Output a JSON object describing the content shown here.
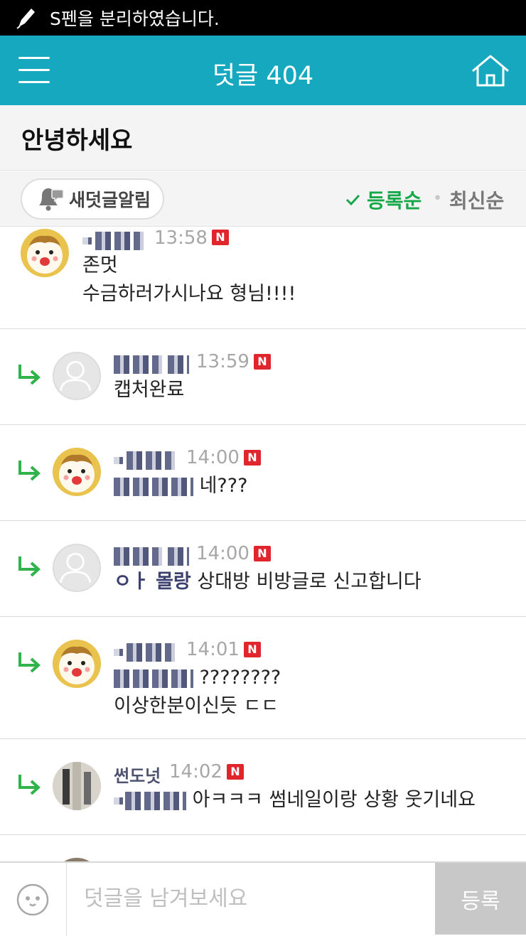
{
  "status_bar": {
    "message": "S펜을 분리하였습니다."
  },
  "header": {
    "title": "덧글 404"
  },
  "post": {
    "title": "안녕하세요"
  },
  "toolbar": {
    "notify_label": "새덧글알림",
    "sort_registered": "등록순",
    "sort_latest": "최신순",
    "active_color": "#17a84a"
  },
  "comments": [
    {
      "time": "13:58",
      "badge": "N",
      "lines": [
        "존멋",
        "수금하러가시나요 형님!!!!"
      ]
    },
    {
      "time": "13:59",
      "badge": "N",
      "lines": [
        "캡처완료"
      ]
    },
    {
      "time": "14:00",
      "badge": "N",
      "text": "네???"
    },
    {
      "time": "14:00",
      "badge": "N",
      "mention": "ㅇㅏ 몰랑",
      "text": "상대방 비방글로 신고합니다"
    },
    {
      "time": "14:01",
      "badge": "N",
      "text": "????????",
      "line2": "이상한분이신듯 ㄷㄷ"
    },
    {
      "time": "14:02",
      "badge": "N",
      "nickname": "썬도넛",
      "text": "아ㅋㅋㅋ 썸네일이랑 상황 웃기네요"
    }
  ],
  "composer": {
    "placeholder": "덧글을 남겨보세요",
    "submit_label": "등록"
  },
  "colors": {
    "header": "#16a8bf",
    "reply_arrow": "#2fb34a",
    "new_badge": "#e0252d"
  }
}
